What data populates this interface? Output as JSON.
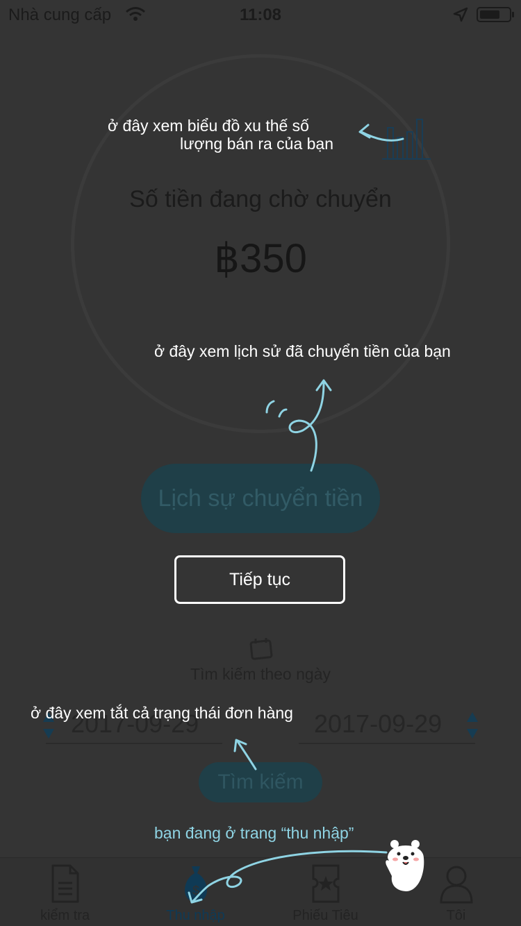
{
  "status_bar": {
    "carrier": "Nhà cung cấp",
    "time": "11:08",
    "icons": [
      "wifi-icon",
      "location-arrow-icon",
      "battery-icon"
    ]
  },
  "income": {
    "pending_label": "Số tiền đang chờ chuyển",
    "pending_amount": "฿350",
    "history_button": "Lịch sự chuyển tiền",
    "trend_icon": "bar-chart-icon"
  },
  "search": {
    "calendar_icon": "calendar-icon",
    "by_date_label": "Tìm kiếm theo ngày",
    "date_from": "2017-09-29",
    "date_to": "2017-09-29",
    "search_button": "Tìm kiếm"
  },
  "tutorial": {
    "note_chart_line1": "ở đây xem biểu đồ xu thế số",
    "note_chart_line2": "lượng bán ra của  bạn",
    "note_history": "ở đây xem lịch  sử đã chuyển tiền của bạn",
    "note_orders": "ở đây xem tắt cả trạng thái đơn hàng",
    "note_income_page": "bạn đang ở trang “thu nhập”",
    "continue_button": "Tiếp tục",
    "mascot": "polar-bear-mascot"
  },
  "tabs": [
    {
      "label": "kiểm tra",
      "icon": "document-icon",
      "active": false
    },
    {
      "label": "Thu nhập",
      "icon": "money-bag-icon",
      "active": true
    },
    {
      "label": "Phiếu Tiêu",
      "icon": "coupon-icon",
      "active": false
    },
    {
      "label": "Tôi",
      "icon": "user-icon",
      "active": false
    }
  ],
  "colors": {
    "overlay": "#343434",
    "accent": "#1f3f48",
    "annotation": "#8fd4e4",
    "active_tab": "#0f3a55"
  }
}
